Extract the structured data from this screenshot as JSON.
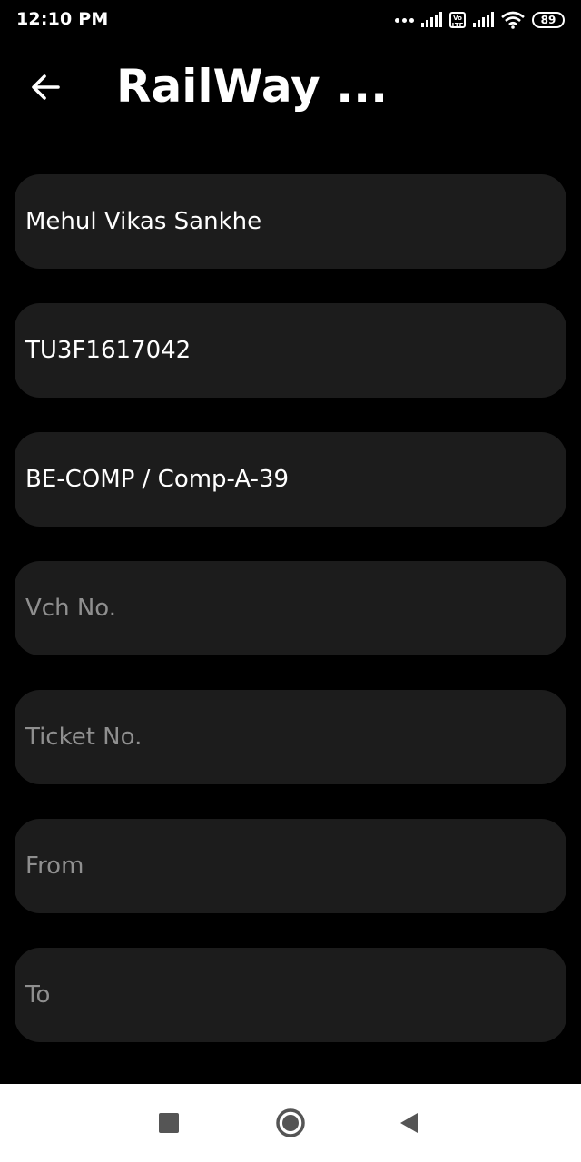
{
  "status_bar": {
    "time": "12:10 PM",
    "volte": "Vo LTE",
    "battery": "89",
    "icons": [
      "more-dots-icon",
      "signal-icon",
      "volte-icon",
      "signal-icon",
      "wifi-icon",
      "battery-icon"
    ]
  },
  "header": {
    "title": "RailWay ...",
    "back_icon": "arrow-left-icon"
  },
  "form": {
    "fields": [
      {
        "name": "student-name",
        "value": "Mehul Vikas Sankhe",
        "placeholder": ""
      },
      {
        "name": "student-id",
        "value": "TU3F1617042",
        "placeholder": ""
      },
      {
        "name": "branch-division",
        "value": "BE-COMP / Comp-A-39",
        "placeholder": ""
      },
      {
        "name": "voucher-number",
        "value": "",
        "placeholder": "Vch No."
      },
      {
        "name": "ticket-number",
        "value": "",
        "placeholder": "Ticket No."
      },
      {
        "name": "from-station",
        "value": "",
        "placeholder": "From"
      },
      {
        "name": "to-station",
        "value": "",
        "placeholder": "To"
      }
    ]
  },
  "nav_bar": {
    "icons": [
      "recents-square-icon",
      "home-circle-icon",
      "back-triangle-icon"
    ]
  },
  "colors": {
    "background": "#000000",
    "field_background": "#1c1c1c",
    "text": "#ffffff",
    "placeholder": "#8f8f8f",
    "nav_bar": "#ffffff",
    "nav_icon": "#555555"
  }
}
